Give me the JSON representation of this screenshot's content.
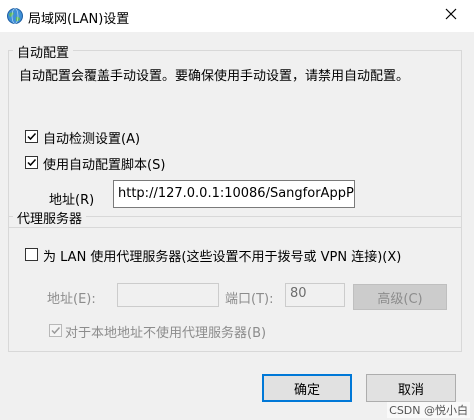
{
  "window": {
    "title": "局域网(LAN)设置"
  },
  "auto_config": {
    "group_title": "自动配置",
    "description": "自动配置会覆盖手动设置。要确保使用手动设置，请禁用自动配置。",
    "auto_detect_label": "自动检测设置(A)",
    "auto_detect_checked": true,
    "use_script_label": "使用自动配置脚本(S)",
    "use_script_checked": true,
    "address_label": "地址(R)",
    "address_value": "http://127.0.0.1:10086/SangforAppP"
  },
  "proxy": {
    "group_title": "代理服务器",
    "use_proxy_label": "为 LAN 使用代理服务器(这些设置不用于拨号或 VPN 连接)(X)",
    "use_proxy_checked": false,
    "address_label": "地址(E):",
    "address_value": "",
    "port_label": "端口(T):",
    "port_value": "80",
    "advanced_label": "高级(C)",
    "bypass_local_label": "对于本地地址不使用代理服务器(B)",
    "bypass_local_checked": true
  },
  "buttons": {
    "ok": "确定",
    "cancel": "取消"
  },
  "watermark": "CSDN @悦小白"
}
